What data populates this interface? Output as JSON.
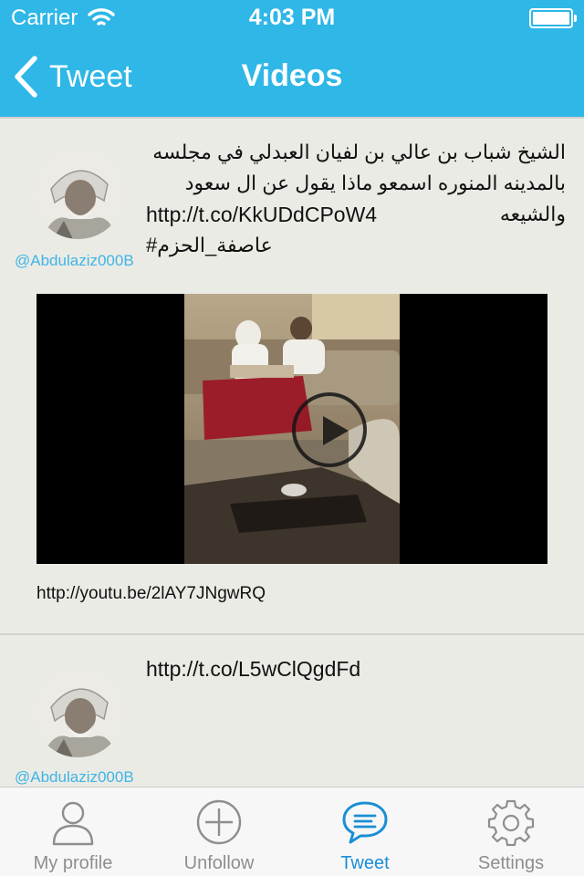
{
  "status_bar": {
    "carrier": "Carrier",
    "time": "4:03 PM"
  },
  "nav": {
    "back_label": "Tweet",
    "title": "Videos"
  },
  "tweets": [
    {
      "text": "الشيخ شباب بن عالي بن لفيان العبدلي في مجلسه بالمدينه المنوره اسمعو ماذا يقول عن ال سعود والشيعه",
      "link": "http://t.co/KkUDdCPoW4",
      "hashtag": "#عاصفة_الحزم",
      "handle": "@Abdulaziz000B",
      "video_link": "http://youtu.be/2lAY7JNgwRQ"
    },
    {
      "link": "http://t.co/L5wClQgdFd",
      "handle": "@Abdulaziz000B"
    }
  ],
  "tabs": [
    {
      "label": "My profile",
      "icon": "person-icon",
      "active": false
    },
    {
      "label": "Unfollow",
      "icon": "plus-circle-icon",
      "active": false
    },
    {
      "label": "Tweet",
      "icon": "speech-bubble-icon",
      "active": true
    },
    {
      "label": "Settings",
      "icon": "gear-icon",
      "active": false
    }
  ],
  "colors": {
    "nav": "#2eb7e7",
    "accent": "#1a8fd6",
    "handle": "#3fb5e4",
    "background": "#ebebe6"
  }
}
